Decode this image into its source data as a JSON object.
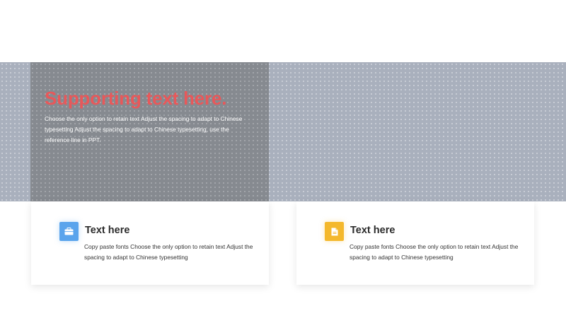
{
  "hero": {
    "title": "Supporting text here.",
    "body": "Choose the only option to retain text Adjust the spacing to adapt to Chinese typesetting Adjust the spacing to adapt to Chinese typesetting, use the reference line in PPT."
  },
  "cards": [
    {
      "icon": "briefcase-icon",
      "icon_color": "#5aa4ec",
      "title": "Text here",
      "body": "Copy paste fonts Choose the only option to retain text Adjust the spacing to adapt to Chinese typesetting"
    },
    {
      "icon": "document-icon",
      "icon_color": "#f4b82c",
      "title": "Text here",
      "body": "Copy paste fonts Choose the only option to retain text Adjust the spacing to adapt to Chinese typesetting"
    }
  ],
  "colors": {
    "accent_red": "#e8585a",
    "band": "#a9b0bd",
    "panel": "#868a90"
  }
}
